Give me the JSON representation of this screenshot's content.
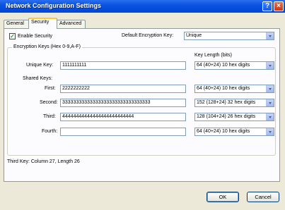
{
  "window": {
    "title": "Network Configuration Settings",
    "help_glyph": "?",
    "close_glyph": "×"
  },
  "tabs": [
    {
      "label": "General"
    },
    {
      "label": "Security"
    },
    {
      "label": "Advanced"
    }
  ],
  "security": {
    "enable_label": "Enable Security",
    "enable_checked_glyph": "✓",
    "default_key_label": "Default Encryption Key:",
    "default_key_value": "Unique",
    "group_title": "Encryption Keys (Hex 0-9,A-F)",
    "key_length_header": "Key Length (bits)",
    "unique": {
      "label": "Unique Key:",
      "value": "1111111111",
      "length": "64  (40+24)  10 hex digits"
    },
    "shared_label": "Shared Keys:",
    "first": {
      "label": "First:",
      "value": "2222222222",
      "length": "64  (40+24)  10 hex digits"
    },
    "second": {
      "label": "Second:",
      "value": "33333333333333333333333333333333",
      "length": "152 (128+24) 32 hex digits"
    },
    "third": {
      "label": "Third:",
      "value": "44444444444444444444444444",
      "length": "128 (104+24) 26 hex digits"
    },
    "fourth": {
      "label": "Fourth:",
      "value": "",
      "length": "64  (40+24)  10 hex digits"
    },
    "status": "Third Key: Column 27,  Length 26"
  },
  "buttons": {
    "ok": "OK",
    "cancel": "Cancel"
  }
}
